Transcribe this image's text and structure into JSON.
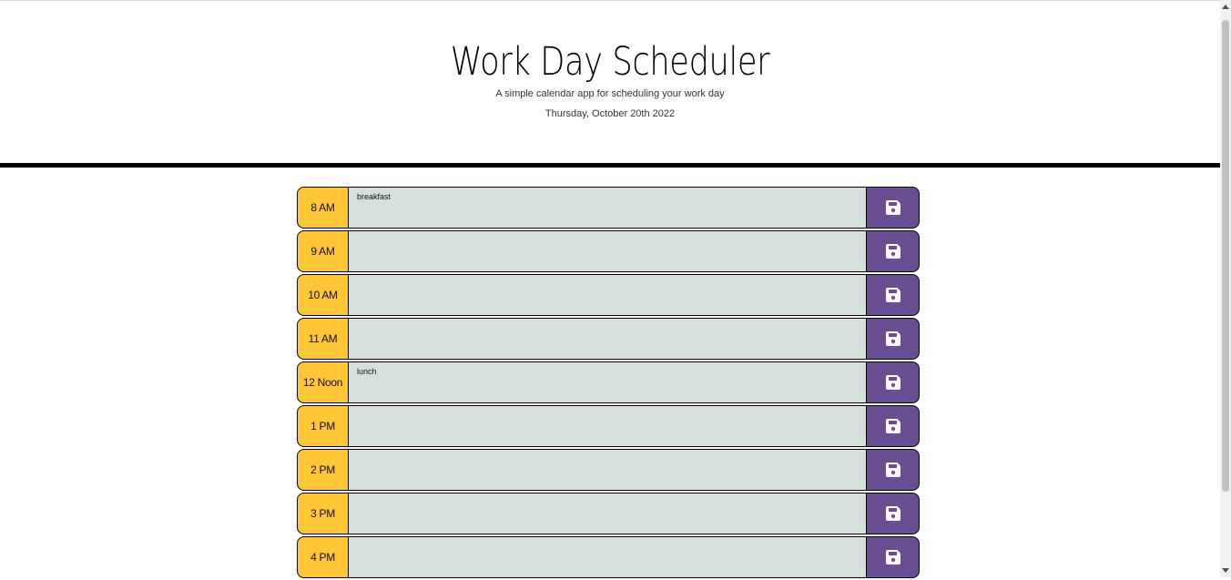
{
  "header": {
    "title": "Work Day Scheduler",
    "subtitle": "A simple calendar app for scheduling your work day",
    "date": "Thursday, October 20th 2022"
  },
  "colors": {
    "hour_bg": "#ffc635",
    "textarea_bg": "#d6e0db",
    "save_bg": "#6a4e93",
    "save_icon": "#ffffff"
  },
  "schedule": [
    {
      "hour": "8 AM",
      "text": "breakfast"
    },
    {
      "hour": "9 AM",
      "text": ""
    },
    {
      "hour": "10 AM",
      "text": ""
    },
    {
      "hour": "11 AM",
      "text": ""
    },
    {
      "hour": "12 Noon",
      "text": "lunch"
    },
    {
      "hour": "1 PM",
      "text": ""
    },
    {
      "hour": "2 PM",
      "text": ""
    },
    {
      "hour": "3 PM",
      "text": ""
    },
    {
      "hour": "4 PM",
      "text": ""
    }
  ],
  "save_icon_name": "floppy-disk-icon"
}
